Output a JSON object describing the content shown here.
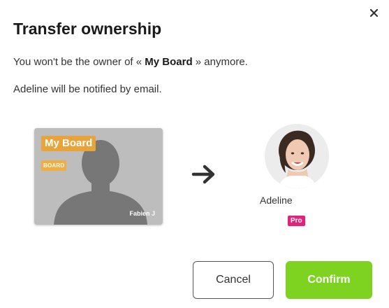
{
  "dialog": {
    "title": "Transfer ownership",
    "message_prefix": "You won't be the owner of « ",
    "board_name": "My Board",
    "message_suffix": " » anymore.",
    "notify_text": "Adeline will be notified by email.",
    "close_icon": "close-icon"
  },
  "board_card": {
    "name": "My Board",
    "type_tag": "BOARD",
    "owner": "Fabien J",
    "tag_color": "#e8a33a"
  },
  "transfer": {
    "arrow_icon": "arrow-right-icon"
  },
  "recipient": {
    "name": "Adeline",
    "badge": "Pro",
    "badge_color": "#e0247a"
  },
  "buttons": {
    "cancel_label": "Cancel",
    "confirm_label": "Confirm",
    "confirm_color": "#7ed321"
  }
}
